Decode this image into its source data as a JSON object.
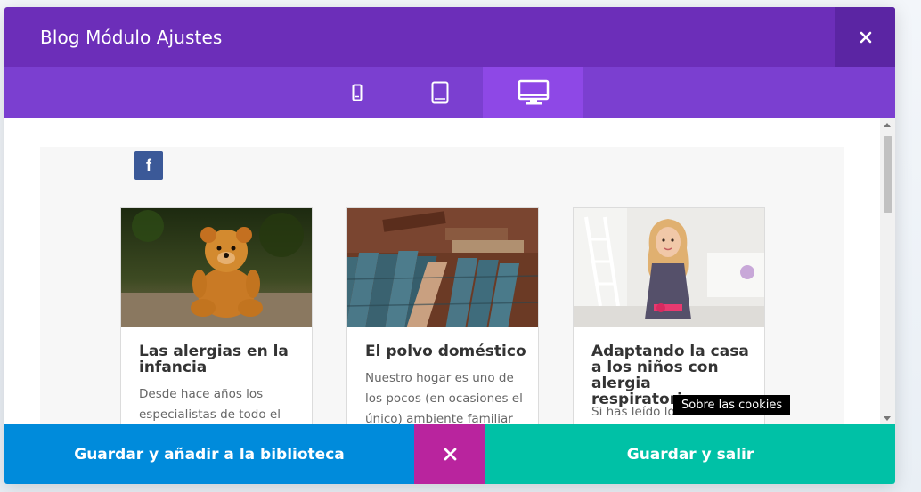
{
  "modal": {
    "title": "Blog Módulo Ajustes",
    "close_icon": "close-icon"
  },
  "device_tabs": [
    {
      "name": "phone",
      "icon": "phone-icon",
      "active": false
    },
    {
      "name": "tablet",
      "icon": "tablet-icon",
      "active": false
    },
    {
      "name": "desktop",
      "icon": "desktop-icon",
      "active": true
    }
  ],
  "social": {
    "facebook_label": "f"
  },
  "posts": [
    {
      "title": "Las alergias en la infancia",
      "excerpt_lines": [
        "Desde hace años los",
        "especialistas de todo el"
      ]
    },
    {
      "title": "El polvo doméstico",
      "excerpt_lines": [
        "Nuestro hogar es uno de",
        "los pocos (en ocasiones el",
        "único) ambiente familiar"
      ]
    },
    {
      "title": "Adaptando la casa a los niños con alergia respiratoria",
      "excerpt_lines": [
        "Si has leído los"
      ]
    }
  ],
  "tooltip": "Sobre las cookies",
  "footer": {
    "save_library": "Guardar y añadir a la biblioteca",
    "discard_icon": "close-icon",
    "save_exit": "Guardar y salir"
  },
  "colors": {
    "header": "#6c2eb9",
    "tabs": "#7b3fd0",
    "tab_active": "#8e48e6",
    "save_library": "#008bdb",
    "discard": "#b9249e",
    "save_exit": "#00c1a6",
    "facebook": "#3b5998"
  }
}
